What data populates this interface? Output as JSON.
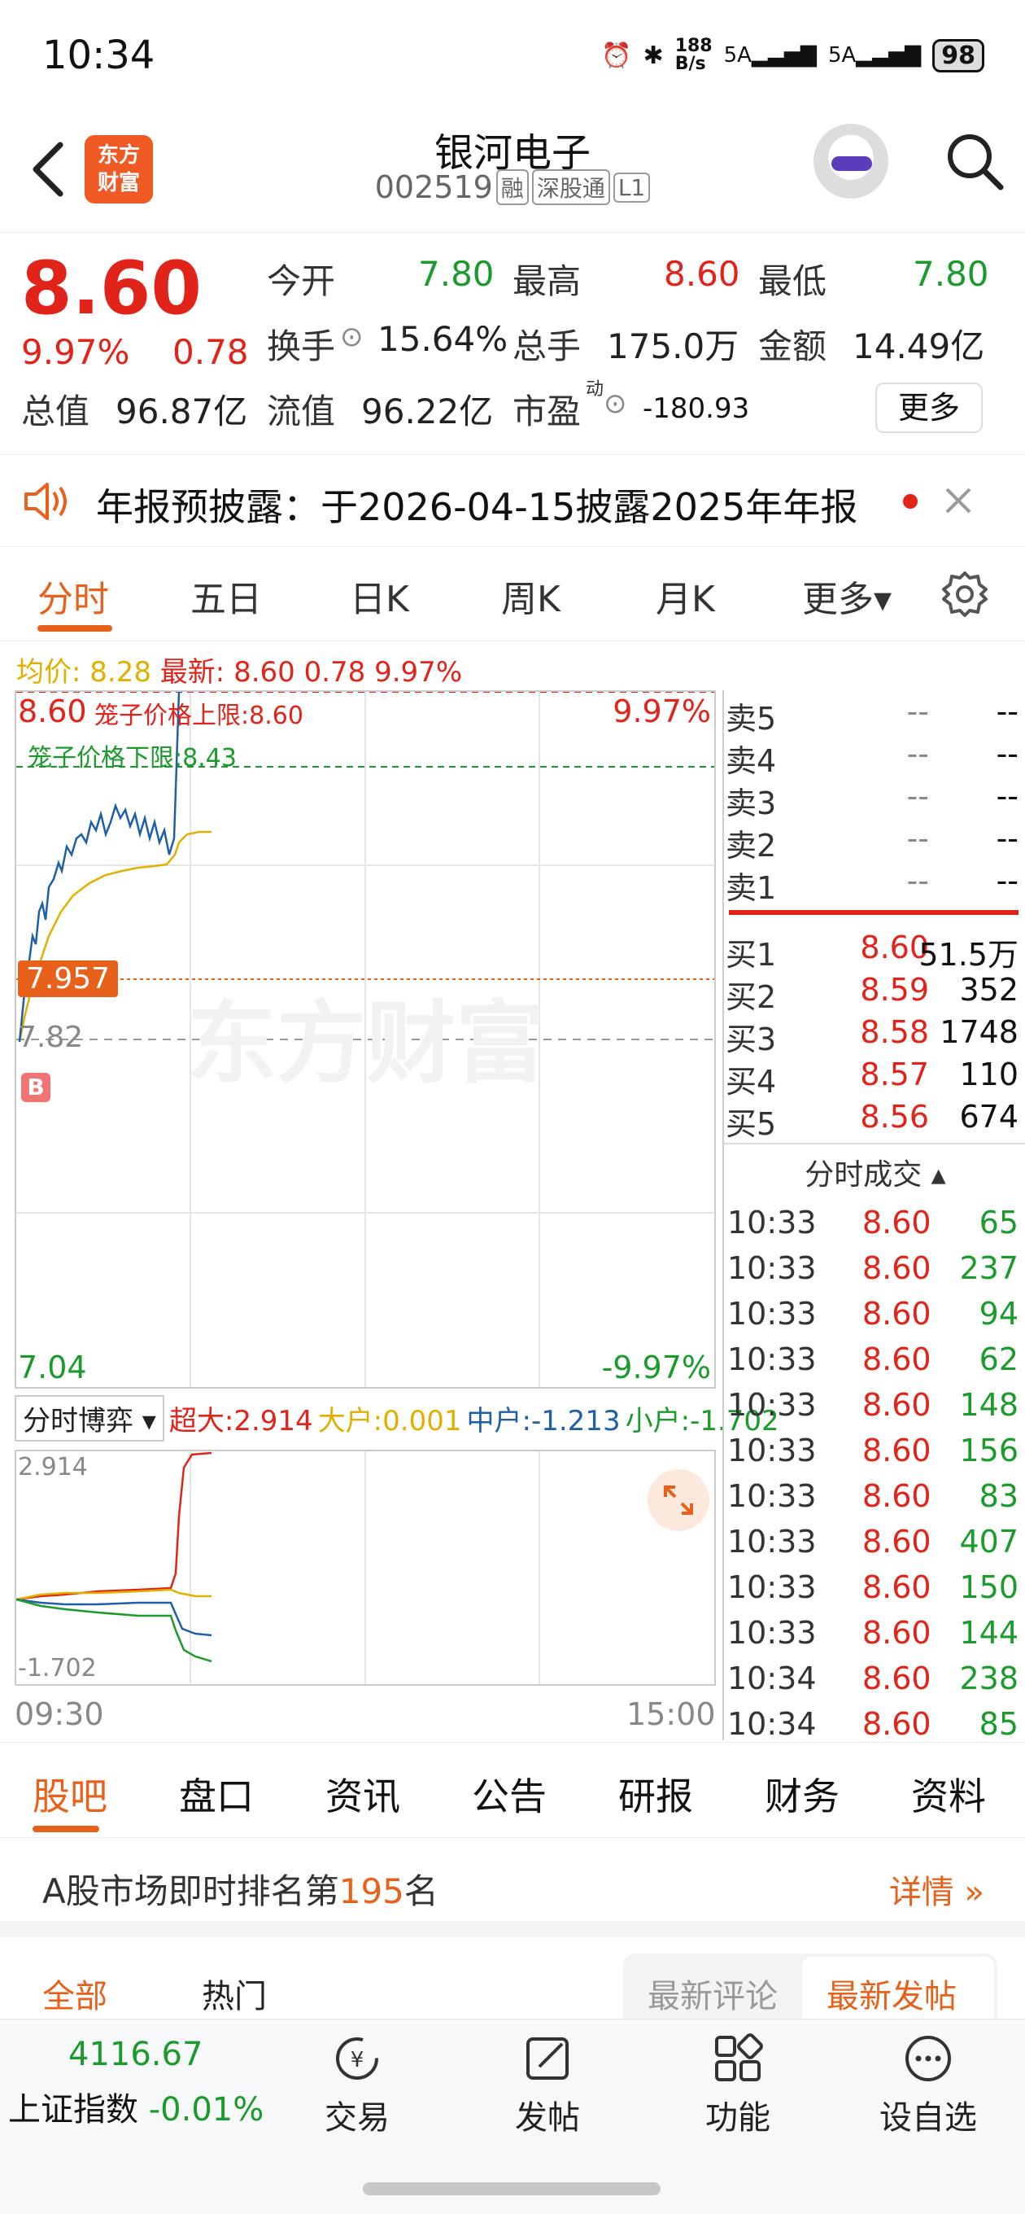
{
  "status_bar": {
    "time": "10:34",
    "net_speed": "188\nB/s",
    "signal1": "5A",
    "signal2": "5A",
    "battery": "98"
  },
  "header": {
    "logo_text": "东方\n财富",
    "stock_name": "银河电子",
    "stock_code": "002519",
    "tags": [
      "融",
      "深股通",
      "L1"
    ]
  },
  "quote": {
    "price": "8.60",
    "pct": "9.97%",
    "change": "0.78",
    "rows": [
      [
        {
          "label": "今开",
          "value": "7.80",
          "color": "green"
        },
        {
          "label": "最高",
          "value": "8.60",
          "color": "red"
        },
        {
          "label": "最低",
          "value": "7.80",
          "color": "green"
        }
      ],
      [
        {
          "label": "换手",
          "value": "15.64%",
          "color": "black"
        },
        {
          "label": "总手",
          "value": "175.0万",
          "color": "black"
        },
        {
          "label": "金额",
          "value": "14.49亿",
          "color": "black"
        }
      ]
    ],
    "zongzhi_label": "总值",
    "zongzhi_value": "96.87亿",
    "liuzhi_label": "流值",
    "liuzhi_value": "96.22亿",
    "shiying_label": "市盈",
    "shiying_sup": "动",
    "shiying_value": "-180.93",
    "more_label": "更多"
  },
  "notice": {
    "text": "年报预披露：于2026-04-15披露2025年年报"
  },
  "tabs": [
    "分时",
    "五日",
    "日K",
    "周K",
    "月K",
    "更多▾"
  ],
  "chart": {
    "legend_avg_label": "均价:",
    "legend_avg": "8.28",
    "legend_latest_label": "最新:",
    "legend_latest": "8.60",
    "legend_change": "0.78",
    "legend_pct": "9.97%",
    "top_price": "8.60",
    "top_pct": "9.97%",
    "cage_upper": "笼子价格上限:8.60",
    "cage_lower": "笼子价格下限:8.43",
    "current_marker": "7.957",
    "prev_close": "7.82",
    "b_marker": "B",
    "bottom_price": "7.04",
    "bottom_pct": "-9.97%",
    "watermark": "东方财富",
    "sub_selector": "分时博弈",
    "sub_super_label": "超大:",
    "sub_super": "2.914",
    "sub_big_label": "大户:",
    "sub_big": "0.001",
    "sub_mid_label": "中户:",
    "sub_mid": "-1.213",
    "sub_small_label": "小户:",
    "sub_small": "-1.702",
    "sub_top": "2.914",
    "sub_bottom": "-1.702",
    "time_start": "09:30",
    "time_end": "15:00"
  },
  "order_book": {
    "sells": [
      {
        "label": "卖5",
        "price": "--",
        "vol": "--"
      },
      {
        "label": "卖4",
        "price": "--",
        "vol": "--"
      },
      {
        "label": "卖3",
        "price": "--",
        "vol": "--"
      },
      {
        "label": "卖2",
        "price": "--",
        "vol": "--"
      },
      {
        "label": "卖1",
        "price": "--",
        "vol": "--"
      }
    ],
    "buys": [
      {
        "label": "买1",
        "price": "8.60",
        "vol": "51.5万"
      },
      {
        "label": "买2",
        "price": "8.59",
        "vol": "352"
      },
      {
        "label": "买3",
        "price": "8.58",
        "vol": "1748"
      },
      {
        "label": "买4",
        "price": "8.57",
        "vol": "110"
      },
      {
        "label": "买5",
        "price": "8.56",
        "vol": "674"
      }
    ],
    "trades_title": "分时成交 ▴",
    "trades": [
      {
        "t": "10:33",
        "p": "8.60",
        "v": "65"
      },
      {
        "t": "10:33",
        "p": "8.60",
        "v": "237"
      },
      {
        "t": "10:33",
        "p": "8.60",
        "v": "94"
      },
      {
        "t": "10:33",
        "p": "8.60",
        "v": "62"
      },
      {
        "t": "10:33",
        "p": "8.60",
        "v": "148"
      },
      {
        "t": "10:33",
        "p": "8.60",
        "v": "156"
      },
      {
        "t": "10:33",
        "p": "8.60",
        "v": "83"
      },
      {
        "t": "10:33",
        "p": "8.60",
        "v": "407"
      },
      {
        "t": "10:33",
        "p": "8.60",
        "v": "150"
      },
      {
        "t": "10:33",
        "p": "8.60",
        "v": "144"
      },
      {
        "t": "10:34",
        "p": "8.60",
        "v": "238"
      },
      {
        "t": "10:34",
        "p": "8.60",
        "v": "85"
      }
    ]
  },
  "bottom_tabs": [
    "股吧",
    "盘口",
    "资讯",
    "公告",
    "研报",
    "财务",
    "资料"
  ],
  "rank": {
    "prefix": "A股市场即时排名第",
    "num": "195",
    "suffix": "名",
    "detail": "详情 »"
  },
  "filters": {
    "all": "全部",
    "hot": "热门",
    "latest_comment": "最新评论",
    "latest_post": "最新发帖"
  },
  "bottom_nav": {
    "index_value": "4116.67",
    "index_name": "上证指数",
    "index_change": "-0.01%",
    "items": [
      "交易",
      "发帖",
      "功能",
      "设自选"
    ]
  },
  "colors": {
    "up": "#e2231a",
    "down": "#1a9b2b",
    "accent": "#e8611a",
    "avg": "#e0b000",
    "mid": "#1f5fa8"
  }
}
